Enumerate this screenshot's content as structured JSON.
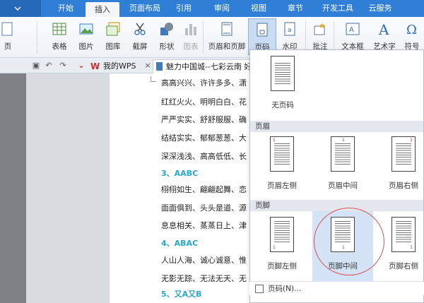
{
  "menubar": {
    "tabs": [
      "开始",
      "插入",
      "页面布局",
      "引用",
      "审阅",
      "视图",
      "章节",
      "开发工具",
      "云服务"
    ],
    "active": "插入"
  },
  "ribbon": {
    "buttons": [
      {
        "label": "页",
        "icon": "page-icon"
      },
      {
        "label": "表格",
        "icon": "table-icon"
      },
      {
        "label": "图片",
        "icon": "picture-icon"
      },
      {
        "label": "图库",
        "icon": "gallery-icon"
      },
      {
        "label": "截屏",
        "icon": "screenshot-icon"
      },
      {
        "label": "形状",
        "icon": "shapes-icon"
      },
      {
        "label": "图表",
        "icon": "chart-icon"
      },
      {
        "label": "页眉和页脚",
        "icon": "header-footer-icon"
      },
      {
        "label": "页码",
        "icon": "page-number-icon"
      },
      {
        "label": "水印",
        "icon": "watermark-icon"
      },
      {
        "label": "批注",
        "icon": "comment-icon"
      },
      {
        "label": "文本框",
        "icon": "textbox-icon"
      },
      {
        "label": "艺术字",
        "icon": "wordart-icon"
      },
      {
        "label": "符号",
        "icon": "symbol-icon"
      }
    ]
  },
  "tabstrip": {
    "wps_tab": "我的WPS",
    "doc_tab": "魅力中国城--七彩云南 好在"
  },
  "document": {
    "lines": [
      {
        "text": "高高兴兴、许许多多、潇",
        "head": false
      },
      {
        "text": "红红火火、明明白白、花",
        "head": false
      },
      {
        "text": "严严实实、舒舒服服、确",
        "head": false
      },
      {
        "text": "结结实实、郁郁葱葱、大",
        "head": false
      },
      {
        "text": "深深浅浅、高高低低、长",
        "head": false
      },
      {
        "text": "3、AABC",
        "head": true
      },
      {
        "text": "栩栩如生、翩翩起舞、恋",
        "head": false
      },
      {
        "text": "面面俱到、头头是道、源",
        "head": false
      },
      {
        "text": "息息相关、蒸蒸日上、津",
        "head": false
      },
      {
        "text": "4、ABAC",
        "head": true
      },
      {
        "text": "人山人海、诚心诚意、惟",
        "head": false
      },
      {
        "text": "无影无踪、无法无天、无",
        "head": false
      },
      {
        "text": "5、又A又B",
        "head": true
      }
    ]
  },
  "dropdown": {
    "none_label": "无页码",
    "header_section": "页眉",
    "footer_section": "页脚",
    "header_options": [
      "页眉左侧",
      "页眉中间",
      "页眉右侧"
    ],
    "footer_options": [
      "页脚左侧",
      "页脚中间",
      "页脚右侧"
    ],
    "selected": "页脚中间",
    "page_number_format": "页码(N)..."
  }
}
